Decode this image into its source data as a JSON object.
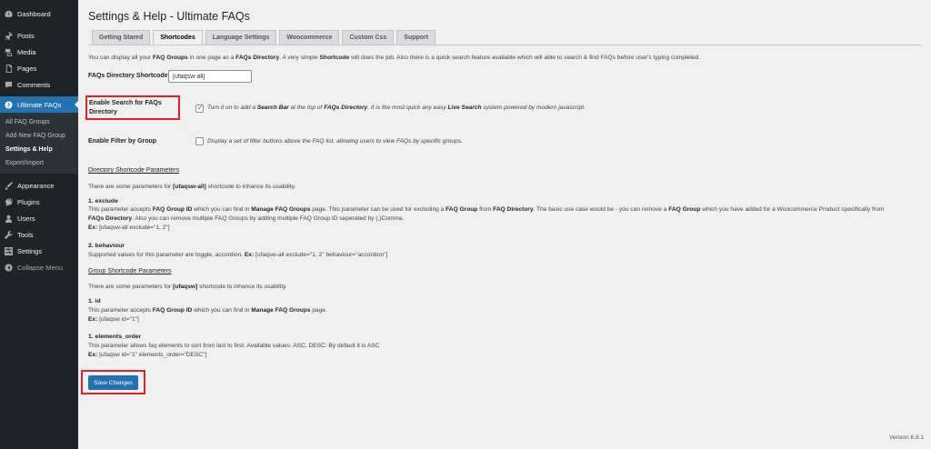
{
  "sidebar": {
    "items": [
      {
        "label": "Dashboard",
        "icon": "dashboard-icon"
      },
      {
        "label": "Posts",
        "icon": "pin-icon"
      },
      {
        "label": "Media",
        "icon": "media-icon"
      },
      {
        "label": "Pages",
        "icon": "pages-icon"
      },
      {
        "label": "Comments",
        "icon": "comments-icon"
      },
      {
        "label": "Ultimate FAQs",
        "icon": "help-icon",
        "active": true
      },
      {
        "label": "Appearance",
        "icon": "brush-icon"
      },
      {
        "label": "Plugins",
        "icon": "plugin-icon"
      },
      {
        "label": "Users",
        "icon": "users-icon"
      },
      {
        "label": "Tools",
        "icon": "wrench-icon"
      },
      {
        "label": "Settings",
        "icon": "settings-icon"
      },
      {
        "label": "Collapse Menu",
        "icon": "collapse-icon"
      }
    ],
    "submenu": [
      "All FAQ Groups",
      "Add New FAQ Group",
      "Settings & Help",
      "Export/Import"
    ]
  },
  "page": {
    "title": "Settings & Help - Ultimate FAQs",
    "tabs": [
      "Getting Stared",
      "Shortcodes",
      "Language Settings",
      "Woocommerce",
      "Custom Css",
      "Support"
    ],
    "intro": {
      "a": "You can display all your ",
      "b": "FAQ Groups",
      "c": " in one page as a ",
      "d": "FAQs Directory",
      "e": ". A very simple ",
      "f": "Shortcode",
      "g": " will does the job. Also there is a quick search feature available which will able to search & find FAQs before user's typing completed."
    },
    "shortcode_label": "FAQs Directory Shortcode:",
    "shortcode_value": "[ufaqsw-all]",
    "search": {
      "label": "Enable Search for FAQs Directory",
      "checked": true,
      "desc": {
        "a": "Turn it on to add a ",
        "b": "Search Bar",
        "c": " at the top of ",
        "d": "FAQs Directory",
        "e": ". It is the most quick any easy ",
        "f": "Live Search",
        "g": " system powered by modern javascript."
      }
    },
    "filter": {
      "label": "Enable Filter by Group",
      "checked": false,
      "desc": "Display a set of filter buttons above the FAQ list, allowing users to view FAQs by specific groups."
    },
    "dir_params": {
      "heading": "Directory Shortcode Parameters",
      "intro": {
        "a": "There are some parameters for ",
        "b": "[ufaqsw-all]",
        "c": " shortcode to inhance its usability."
      },
      "exclude": {
        "title": "1. exclude",
        "line1": {
          "a": "This parameter accepts ",
          "b": "FAQ Group ID",
          "c": " which you can find in ",
          "d": "Manage FAQ Groups",
          "e": " page. This parameter can be used for excluding a ",
          "f": "FAQ Group",
          "g": " from ",
          "h": "FAQ Directory",
          "i": ". The basic use case would be - you can remove a ",
          "j": "FAQ Group",
          "k": " which you have added for a Woocommerce Product specifically from"
        },
        "line2": {
          "a": "FAQs Directory",
          "b": ". Also you can remove multiple FAQ Groups by adding multiple FAQ Group ID seperated by (,)Comma."
        },
        "example": {
          "a": "Ex:",
          "b": " [ufaqsw-all exclude=\"1, 2\"]"
        }
      },
      "behaviour": {
        "title": "2. behaviour",
        "desc": {
          "a": "Supported values for this parameter are toggle, accordion. ",
          "b": "Ex:",
          "c": " [ufaqsw-all exclude=\"1, 2\" behaviour=\"accordion\"]"
        }
      }
    },
    "group_params": {
      "heading": "Group Shortcode Parameters",
      "intro": {
        "a": "There are some parameters for ",
        "b": "[ufaqsw]",
        "c": " shortcode to inhance its usability."
      },
      "id": {
        "title": "1. id",
        "desc": {
          "a": "This parameter accepts ",
          "b": "FAQ Group ID",
          "c": " which you can find in ",
          "d": "Manage FAQ Groups",
          "e": " page."
        },
        "example": {
          "a": "Ex:",
          "b": " [ufaqsw id=\"1\"]"
        }
      },
      "order": {
        "title": "1. elements_order",
        "desc": "This parameter allows faq elements to sort from last to first. Available values: ASC, DESC. By default it is ASC",
        "example": {
          "a": "Ex:",
          "b": " [ufaqsw id=\"1\" elements_order=\"DESC\"]"
        }
      }
    },
    "save_label": "Save Changes",
    "version": "Version 6.8.1"
  },
  "colors": {
    "sidebar_bg": "#1d2327",
    "accent": "#2271b1",
    "highlight_border": "#e0202a"
  }
}
